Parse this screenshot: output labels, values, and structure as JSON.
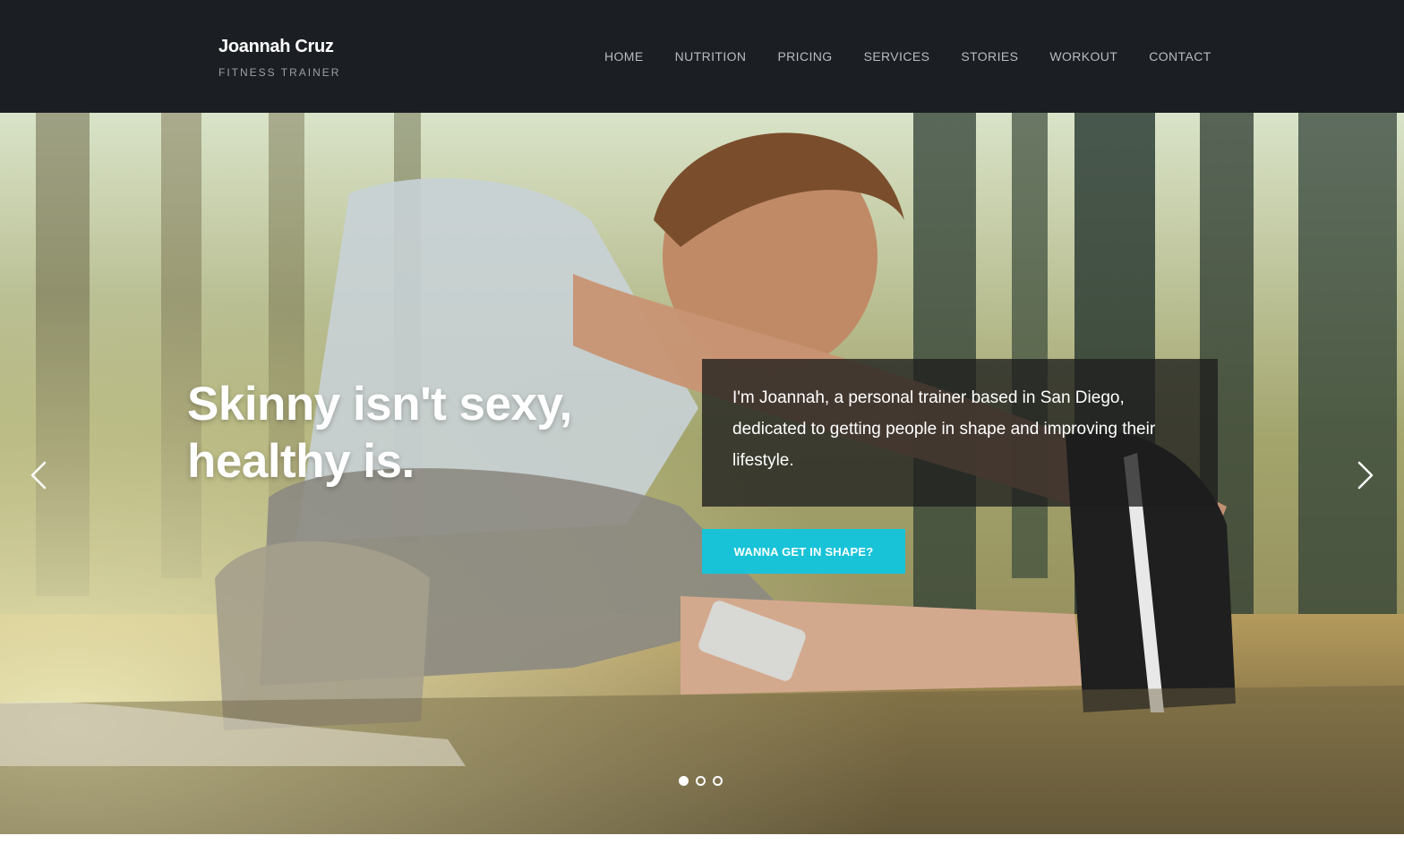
{
  "header": {
    "brand_name": "Joannah Cruz",
    "brand_tagline": "FITNESS TRAINER",
    "nav": [
      {
        "label": "HOME"
      },
      {
        "label": "NUTRITION"
      },
      {
        "label": "PRICING"
      },
      {
        "label": "SERVICES"
      },
      {
        "label": "STORIES"
      },
      {
        "label": "WORKOUT"
      },
      {
        "label": "CONTACT"
      }
    ]
  },
  "hero": {
    "headline_line1": "Skinny isn't sexy,",
    "headline_line2": "healthy is.",
    "intro": "I'm Joannah, a personal trainer based in San Diego, dedicated to getting people in shape and improving their lifestyle.",
    "cta_label": "WANNA GET IN SHAPE?",
    "prev_icon": "chevron-left-icon",
    "next_icon": "chevron-right-icon",
    "slides": [
      {
        "active": true
      },
      {
        "active": false
      },
      {
        "active": false
      }
    ]
  },
  "colors": {
    "header_bg": "#1b1f23",
    "accent": "#18c3d8",
    "intro_box_bg": "#1e1e1e",
    "nav_text": "#b8bcc0"
  }
}
